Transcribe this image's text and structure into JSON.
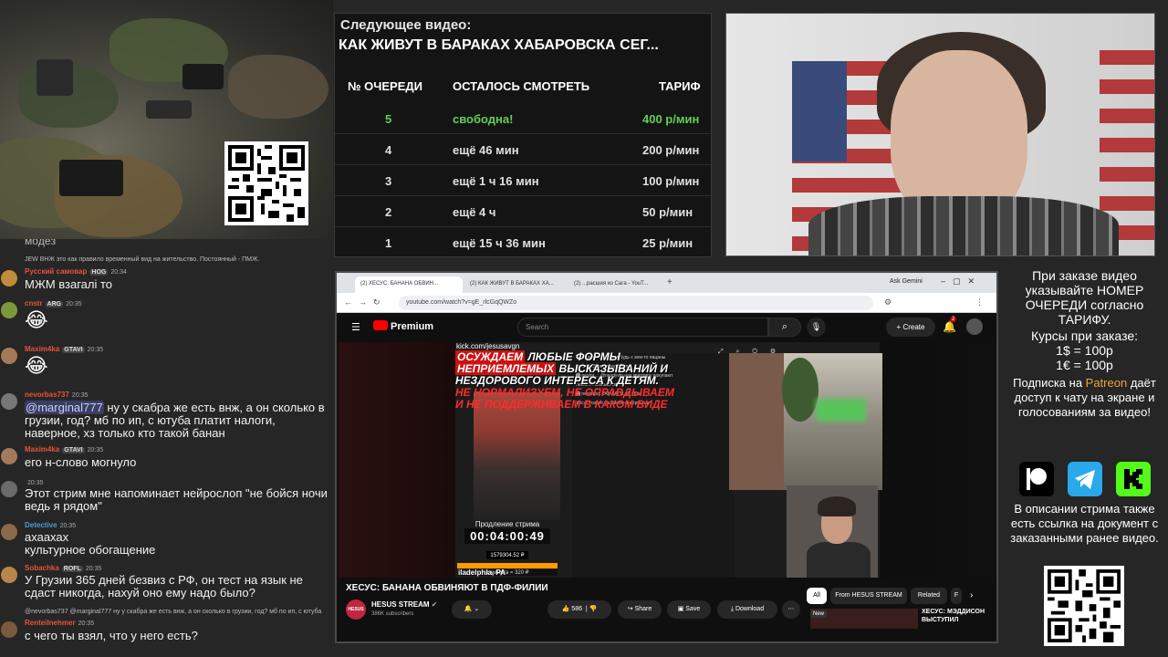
{
  "queue": {
    "next_label": "Следующее видео:",
    "next_title": "КАК ЖИВУТ В БАРАКАХ ХАБАРОВСКА СЕГ...",
    "headers": {
      "num": "№ ОЧЕРЕДИ",
      "left": "ОСТАЛОСЬ СМОТРЕТЬ",
      "tariff": "ТАРИФ"
    },
    "rows": [
      {
        "num": "5",
        "left": "свободна!",
        "tariff": "400 р/мин",
        "status": "free"
      },
      {
        "num": "4",
        "left": "ещё 46 мин",
        "tariff": "200 р/мин",
        "status": "busy"
      },
      {
        "num": "3",
        "left": "ещё 1 ч 16 мин",
        "tariff": "100 р/мин",
        "status": "busy"
      },
      {
        "num": "2",
        "left": "ещё 4 ч",
        "tariff": "50 р/мин",
        "status": "busy"
      },
      {
        "num": "1",
        "left": "ещё 15 ч 36 мин",
        "tariff": "25 р/мин",
        "status": "busy"
      }
    ]
  },
  "chat": {
    "messages": [
      {
        "reply_user": "JEW",
        "reply_text": "ВНЖ это как правило временный вид на жительство. Постоянный - ПМЖ."
      },
      {
        "user": "Русский самовар",
        "user_color": "#e5533b",
        "badge": "HOG",
        "time": "20:34",
        "text": "МЖМ взагалі то",
        "avatar_color": "#c28b3a"
      },
      {
        "user": "cnstr",
        "user_color": "#e5533b",
        "badge": "ARG",
        "time": "20:35",
        "text": "",
        "emoji": "😂",
        "avatar_color": "#7a9a3a"
      },
      {
        "user": "Maxim4ka",
        "user_color": "#e5533b",
        "badge": "GTAVI",
        "time": "20:35",
        "text": "",
        "emoji": "😂",
        "avatar_color": "#a47a5a"
      },
      {
        "user": "nevorbas737",
        "user_color": "#e5533b",
        "badge": "",
        "time": "20:35",
        "mention": "@marginal777",
        "text": " ну у скабра же есть внж, а он сколько в грузии, год? мб по ип, с ютуба платит налоги, наверное, хз только кто такой банан",
        "avatar_color": "#777777"
      },
      {
        "user": "Maxim4ka",
        "user_color": "#e5533b",
        "badge": "GTAVI",
        "time": "20:35",
        "text": "его н-слово могнуло",
        "avatar_color": "#a47a5a"
      },
      {
        "user": "",
        "user_color": "#e5533b",
        "badge": "",
        "time": "20:35",
        "text": "Этот стрим мне напоминает нейрослоп \"не бойся ночи ведь я рядом\"",
        "avatar_color": "#6b6b6b"
      },
      {
        "user": "Detective",
        "user_color": "#4a9bd9",
        "badge": "",
        "time": "20:35",
        "text": "ахаахах\nкультурное обогащение",
        "avatar_color": "#8a6a4a"
      },
      {
        "user": "Sobachka",
        "user_color": "#e5533b",
        "badge": "ROFL",
        "time": "20:35",
        "text": "У Грузии 365 дней безвиз с РФ, он тест на язык не сдаст никогда, нахуй оно ему надо было?",
        "avatar_color": "#b8864a"
      },
      {
        "reply_user": "@nevorbas737",
        "reply_text": "@marginal777 ну у скабра же есть внж, а он сколько в грузии, год? мб по ип, с ютуба"
      },
      {
        "user": "Renteilnehmer",
        "user_color": "#e5533b",
        "badge": "",
        "time": "20:35",
        "text": "с чего ты взял, что у него есть?",
        "avatar_color": "#7a5a3a"
      }
    ],
    "partial_top": "мoдeз"
  },
  "browser": {
    "tabs": [
      "(2) ХЕСУС: БАНАНА ОБВИН...",
      "(2) КАК ЖИВУТ В БАРАКАХ ХА...",
      "(2) ...расшия из Сага - YouT..."
    ],
    "url": "youtube.com/watch?v=gE_rlcGqQWZo",
    "ask_gemini": "Ask Gemini",
    "search_placeholder": "Search",
    "premium_label": "Premium",
    "create_label": "Create",
    "notif_count": "2",
    "video": {
      "kick_url": "kick.com/jesusavgn",
      "warn_line1_red": "ОСУЖДАЕМ",
      "warn_line1_white": " ЛЮБЫЕ ФОРМЫ",
      "warn_line2_red": "НЕПРИЕМЛЕМЫХ",
      "warn_line2_white": " ВЫСКАЗЫВАНИЙ И",
      "warn_line3_white": "НЕЗДОРОВОГО ИНТЕРЕСА К ДЕТЯМ.",
      "warn_line4_red": "НЕ НОРМАЛИЗУЕМ, НЕ ОПРАВДЫВАЕМ",
      "warn_line5_red": "И НЕ ПОДДЕРЖИВАЕМ В КАКОМ ВИДЕ",
      "extension_label": "Продление стрима",
      "timer": "00:04:00:49",
      "sum": "1579304.52 ₽",
      "bottom_line": "1 минута = 320 ₽",
      "location": "iladelphia, PA",
      "chat_lines": [
        "Ternaty может что-нибудь с кем-то пацаны",
        "вилиам25: я их нелюбил",
        "🅑 nestor...: @nesdyvtg нах квартиру покупают",
        "nestor...: сколько кв...",
        "🅑 nestorpq: ТАК ДА! Я об этом",
        "Хесус* сидит на Бизон-интервью и ..."
      ]
    },
    "title": "ХЕСУС: БАНАНА ОБВИНЯЮТ В ПДФ-ФИЛИИ",
    "channel": {
      "name": "HESUS STREAM",
      "subs": "386K subscribers",
      "avatar_text": "HESUS"
    },
    "actions": {
      "likes": "586",
      "share": "Share",
      "save": "Save",
      "download": "Download"
    },
    "chips": [
      "All",
      "From HESUS STREAM",
      "Related",
      "F"
    ],
    "side": {
      "new": "New",
      "title": "ХЕСУС: МЭДДИСОН ВЫСТУПИЛ"
    }
  },
  "info": {
    "order_text": "При заказе видео указывайте НОМЕР ОЧЕРЕДИ согласно ТАРИФУ.",
    "rates_title": "Курсы при заказе:",
    "rate_usd": "1$ = 100р",
    "rate_eur": "1€ = 100р",
    "patreon_pre": "Подписка на ",
    "patreon_word": "Patreon",
    "patreon_post": " даёт доступ к чату на экране и голосованиям за видео!",
    "doc_text": "В описании стрима также есть ссылка на документ с заказанными ранее видео.",
    "socials": [
      {
        "icon": "patreon-icon",
        "color": "#000000"
      },
      {
        "icon": "telegram-icon",
        "color": "#29a9eb"
      },
      {
        "icon": "kick-icon",
        "color": "#53fc18"
      }
    ]
  }
}
